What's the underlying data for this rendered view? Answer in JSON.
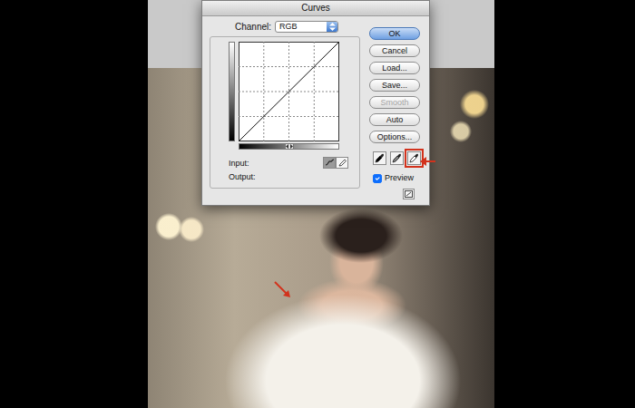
{
  "window": {
    "title": "Curves"
  },
  "channel": {
    "label": "Channel:",
    "value": "RGB"
  },
  "curve": {
    "points": [
      [
        0,
        0
      ],
      [
        255,
        255
      ]
    ]
  },
  "input_label": "Input:",
  "output_label": "Output:",
  "curve_modes": [
    {
      "kind": "curve",
      "selected": true
    },
    {
      "kind": "pencil",
      "selected": false
    }
  ],
  "buttons": [
    {
      "label": "OK",
      "default": true,
      "disabled": false
    },
    {
      "label": "Cancel",
      "default": false,
      "disabled": false
    },
    {
      "label": "Load...",
      "default": false,
      "disabled": false
    },
    {
      "label": "Save...",
      "default": false,
      "disabled": false
    },
    {
      "label": "Smooth",
      "default": false,
      "disabled": true
    },
    {
      "label": "Auto",
      "default": false,
      "disabled": false
    },
    {
      "label": "Options...",
      "default": false,
      "disabled": false
    }
  ],
  "eyedroppers": [
    {
      "color": "#000000",
      "selected": false
    },
    {
      "color": "#808080",
      "selected": false
    },
    {
      "color": "#ffffff",
      "selected": true
    }
  ],
  "preview": {
    "label": "Preview",
    "checked": true
  }
}
